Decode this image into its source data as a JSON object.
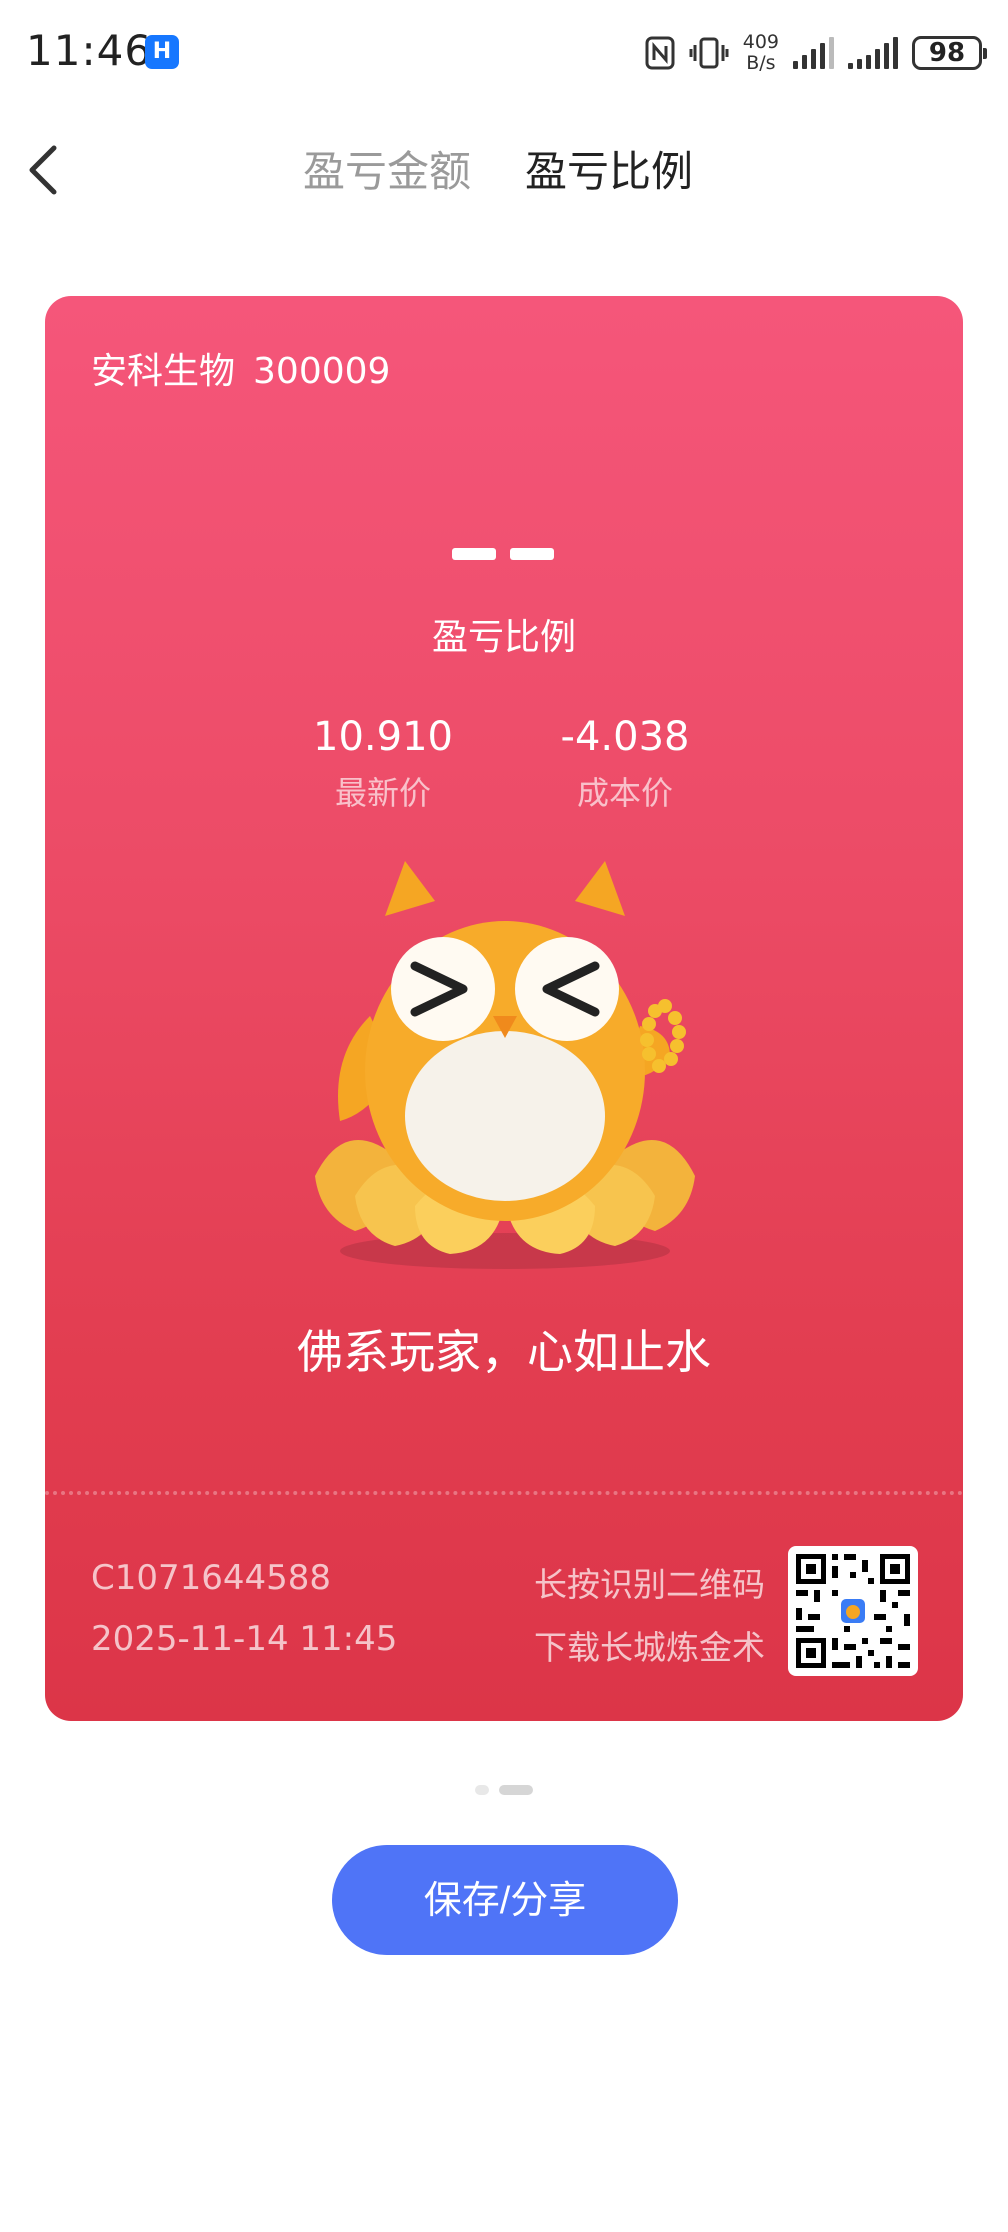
{
  "status_bar": {
    "time": "11:46",
    "app_icon_glyph": "H",
    "net_speed_value": "409",
    "net_speed_unit": "B/s",
    "battery": "98",
    "icons": [
      "nfc-icon",
      "vibrate-icon",
      "signal-icon",
      "signal-icon"
    ]
  },
  "header": {
    "tabs": [
      {
        "label": "盈亏金额",
        "active": false
      },
      {
        "label": "盈亏比例",
        "active": true
      }
    ]
  },
  "card": {
    "stock_name": "安科生物",
    "stock_code": "300009",
    "ratio_value": "——",
    "ratio_label": "盈亏比例",
    "latest_price": {
      "value": "10.910",
      "label": "最新价"
    },
    "cost_price": {
      "value": "-4.038",
      "label": "成本价"
    },
    "slogan": "佛系玩家，心如止水",
    "account": "C1071644588",
    "datetime": "2025-11-14 11:45",
    "qr_hint_line1": "长按识别二维码",
    "qr_hint_line2": "下载长城炼金术"
  },
  "pager": {
    "count": 2,
    "active_index": 1
  },
  "save_button": {
    "label": "保存/分享"
  },
  "colors": {
    "card_top": "#f5567a",
    "card_bottom": "#dc3548",
    "button": "#4f74f7"
  }
}
